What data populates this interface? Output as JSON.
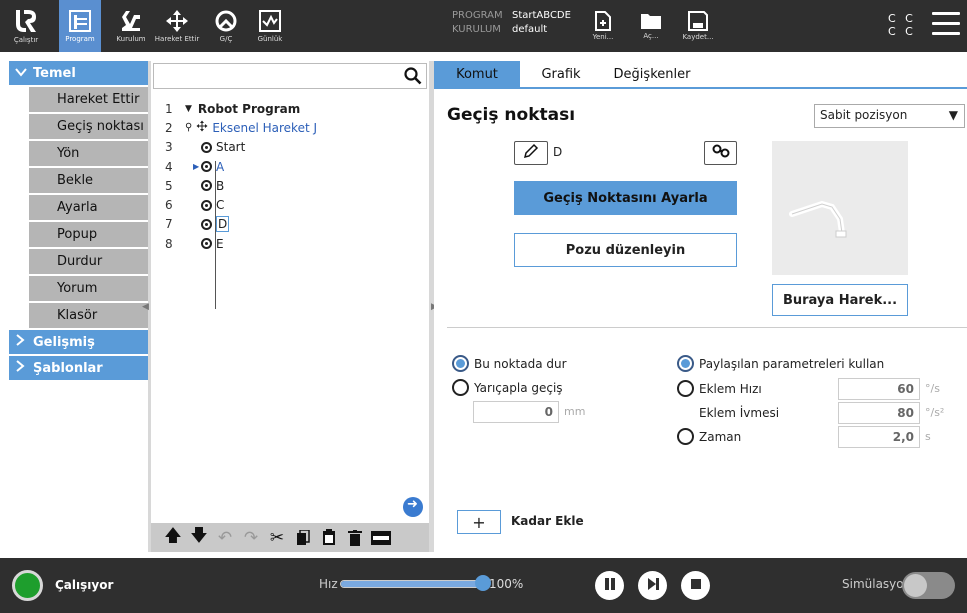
{
  "topbar": {
    "nav": [
      {
        "label": "Çalıştır",
        "icon": "ur-logo-icon"
      },
      {
        "label": "Program",
        "icon": "program-icon",
        "active": true
      },
      {
        "label": "Kurulum",
        "icon": "installation-icon"
      },
      {
        "label": "Hareket Ettir",
        "icon": "move-icon"
      },
      {
        "label": "G/Ç",
        "icon": "io-icon"
      },
      {
        "label": "Günlük",
        "icon": "log-icon"
      }
    ],
    "program_key": "PROGRAM",
    "program_value": "StartABCDE",
    "installation_key": "KURULUM",
    "installation_value": "default",
    "file_buttons": [
      {
        "label": "Yeni...",
        "icon": "new-file-icon"
      },
      {
        "label": "Aç...",
        "icon": "open-folder-icon"
      },
      {
        "label": "Kaydet...",
        "icon": "save-icon"
      }
    ],
    "cc_line1": "C C",
    "cc_line2": "C C"
  },
  "leftnav": {
    "basic_label": "Temel",
    "basic_items": [
      "Hareket Ettir",
      "Geçiş noktası",
      "Yön",
      "Bekle",
      "Ayarla",
      "Popup",
      "Durdur",
      "Yorum",
      "Klasör"
    ],
    "advanced_label": "Gelişmiş",
    "templates_label": "Şablonlar"
  },
  "tree": {
    "search_value": "",
    "rows": [
      {
        "num": "1",
        "text": "Robot Program"
      },
      {
        "num": "2",
        "text": "Eksenel Hareket J"
      },
      {
        "num": "3",
        "text": "Start"
      },
      {
        "num": "4",
        "text": "A"
      },
      {
        "num": "5",
        "text": "B"
      },
      {
        "num": "6",
        "text": "C"
      },
      {
        "num": "7",
        "text": "D"
      },
      {
        "num": "8",
        "text": "E"
      }
    ]
  },
  "right": {
    "tabs": [
      "Komut",
      "Grafik",
      "Değişkenler"
    ],
    "active_tab": "Komut",
    "title": "Geçiş noktası",
    "position_select": "Sabit pozisyon",
    "waypoint_name": "D",
    "set_waypoint_label": "Geçiş Noktasını Ayarla",
    "edit_pose_label": "Pozu düzenleyin",
    "move_here_label": "Buraya Harek...",
    "stop_here_label": "Bu noktada dur",
    "blend_label": "Yarıçapla geçiş",
    "blend_value": "0",
    "blend_unit": "mm",
    "shared_params_label": "Paylaşılan parametreleri kullan",
    "joint_speed_label": "Eklem Hızı",
    "joint_speed_value": "60",
    "joint_speed_unit": "°/s",
    "joint_accel_label": "Eklem İvmesi",
    "joint_accel_value": "80",
    "joint_accel_unit": "°/s²",
    "time_label": "Zaman",
    "time_value": "2,0",
    "time_unit": "s",
    "add_until_symbol": "+",
    "add_until_label": "Kadar Ekle"
  },
  "bottombar": {
    "status": "Çalışıyor",
    "speed_label": "Hız",
    "speed_percent_text": "100%",
    "speed_fraction": 1.0,
    "simulation_label": "Simülasyon"
  },
  "colors": {
    "accent": "#5a9bd8",
    "topbar_bg": "#2f2f2f",
    "running_green": "#1e9e2d"
  }
}
